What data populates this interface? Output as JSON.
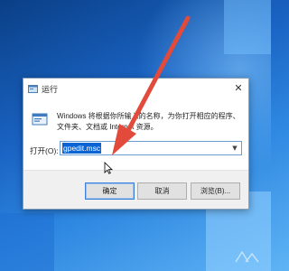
{
  "dialog": {
    "title": "运行",
    "description": "Windows 将根据你所输入的名称，为你打开相应的程序、文件夹、文档或 Internet 资源。",
    "open_label": "打开(O):",
    "open_value": "gpedit.msc"
  },
  "buttons": {
    "ok": "确定",
    "cancel": "取消",
    "browse": "浏览(B)..."
  },
  "icons": {
    "title": "run-icon",
    "content": "run-program-icon",
    "close": "close-icon",
    "dropdown": "chevron-down-icon",
    "cursor": "mouse-pointer-icon",
    "annotation": "red-arrow"
  },
  "colors": {
    "annotation_arrow": "#e24a3b",
    "selection": "#0a64d6",
    "desktop_blue": "#1a64c4"
  }
}
